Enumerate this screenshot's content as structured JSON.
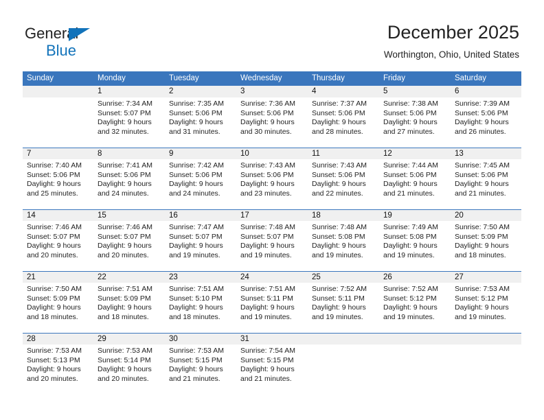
{
  "logo": {
    "word1": "General",
    "word2": "Blue",
    "accent_color": "#1273ba",
    "triangle_icon": "triangle-icon"
  },
  "header": {
    "title": "December 2025",
    "subtitle": "Worthington, Ohio, United States"
  },
  "theme": {
    "header_blue": "#3a76bd",
    "daynum_gray": "#f0f0f0",
    "text": "#222222"
  },
  "weekdays": [
    "Sunday",
    "Monday",
    "Tuesday",
    "Wednesday",
    "Thursday",
    "Friday",
    "Saturday"
  ],
  "weeks": [
    [
      {
        "day": "",
        "sunrise": "",
        "sunset": "",
        "daylight1": "",
        "daylight2": ""
      },
      {
        "day": "1",
        "sunrise": "Sunrise: 7:34 AM",
        "sunset": "Sunset: 5:07 PM",
        "daylight1": "Daylight: 9 hours",
        "daylight2": "and 32 minutes."
      },
      {
        "day": "2",
        "sunrise": "Sunrise: 7:35 AM",
        "sunset": "Sunset: 5:06 PM",
        "daylight1": "Daylight: 9 hours",
        "daylight2": "and 31 minutes."
      },
      {
        "day": "3",
        "sunrise": "Sunrise: 7:36 AM",
        "sunset": "Sunset: 5:06 PM",
        "daylight1": "Daylight: 9 hours",
        "daylight2": "and 30 minutes."
      },
      {
        "day": "4",
        "sunrise": "Sunrise: 7:37 AM",
        "sunset": "Sunset: 5:06 PM",
        "daylight1": "Daylight: 9 hours",
        "daylight2": "and 28 minutes."
      },
      {
        "day": "5",
        "sunrise": "Sunrise: 7:38 AM",
        "sunset": "Sunset: 5:06 PM",
        "daylight1": "Daylight: 9 hours",
        "daylight2": "and 27 minutes."
      },
      {
        "day": "6",
        "sunrise": "Sunrise: 7:39 AM",
        "sunset": "Sunset: 5:06 PM",
        "daylight1": "Daylight: 9 hours",
        "daylight2": "and 26 minutes."
      }
    ],
    [
      {
        "day": "7",
        "sunrise": "Sunrise: 7:40 AM",
        "sunset": "Sunset: 5:06 PM",
        "daylight1": "Daylight: 9 hours",
        "daylight2": "and 25 minutes."
      },
      {
        "day": "8",
        "sunrise": "Sunrise: 7:41 AM",
        "sunset": "Sunset: 5:06 PM",
        "daylight1": "Daylight: 9 hours",
        "daylight2": "and 24 minutes."
      },
      {
        "day": "9",
        "sunrise": "Sunrise: 7:42 AM",
        "sunset": "Sunset: 5:06 PM",
        "daylight1": "Daylight: 9 hours",
        "daylight2": "and 24 minutes."
      },
      {
        "day": "10",
        "sunrise": "Sunrise: 7:43 AM",
        "sunset": "Sunset: 5:06 PM",
        "daylight1": "Daylight: 9 hours",
        "daylight2": "and 23 minutes."
      },
      {
        "day": "11",
        "sunrise": "Sunrise: 7:43 AM",
        "sunset": "Sunset: 5:06 PM",
        "daylight1": "Daylight: 9 hours",
        "daylight2": "and 22 minutes."
      },
      {
        "day": "12",
        "sunrise": "Sunrise: 7:44 AM",
        "sunset": "Sunset: 5:06 PM",
        "daylight1": "Daylight: 9 hours",
        "daylight2": "and 21 minutes."
      },
      {
        "day": "13",
        "sunrise": "Sunrise: 7:45 AM",
        "sunset": "Sunset: 5:06 PM",
        "daylight1": "Daylight: 9 hours",
        "daylight2": "and 21 minutes."
      }
    ],
    [
      {
        "day": "14",
        "sunrise": "Sunrise: 7:46 AM",
        "sunset": "Sunset: 5:07 PM",
        "daylight1": "Daylight: 9 hours",
        "daylight2": "and 20 minutes."
      },
      {
        "day": "15",
        "sunrise": "Sunrise: 7:46 AM",
        "sunset": "Sunset: 5:07 PM",
        "daylight1": "Daylight: 9 hours",
        "daylight2": "and 20 minutes."
      },
      {
        "day": "16",
        "sunrise": "Sunrise: 7:47 AM",
        "sunset": "Sunset: 5:07 PM",
        "daylight1": "Daylight: 9 hours",
        "daylight2": "and 19 minutes."
      },
      {
        "day": "17",
        "sunrise": "Sunrise: 7:48 AM",
        "sunset": "Sunset: 5:07 PM",
        "daylight1": "Daylight: 9 hours",
        "daylight2": "and 19 minutes."
      },
      {
        "day": "18",
        "sunrise": "Sunrise: 7:48 AM",
        "sunset": "Sunset: 5:08 PM",
        "daylight1": "Daylight: 9 hours",
        "daylight2": "and 19 minutes."
      },
      {
        "day": "19",
        "sunrise": "Sunrise: 7:49 AM",
        "sunset": "Sunset: 5:08 PM",
        "daylight1": "Daylight: 9 hours",
        "daylight2": "and 19 minutes."
      },
      {
        "day": "20",
        "sunrise": "Sunrise: 7:50 AM",
        "sunset": "Sunset: 5:09 PM",
        "daylight1": "Daylight: 9 hours",
        "daylight2": "and 18 minutes."
      }
    ],
    [
      {
        "day": "21",
        "sunrise": "Sunrise: 7:50 AM",
        "sunset": "Sunset: 5:09 PM",
        "daylight1": "Daylight: 9 hours",
        "daylight2": "and 18 minutes."
      },
      {
        "day": "22",
        "sunrise": "Sunrise: 7:51 AM",
        "sunset": "Sunset: 5:09 PM",
        "daylight1": "Daylight: 9 hours",
        "daylight2": "and 18 minutes."
      },
      {
        "day": "23",
        "sunrise": "Sunrise: 7:51 AM",
        "sunset": "Sunset: 5:10 PM",
        "daylight1": "Daylight: 9 hours",
        "daylight2": "and 18 minutes."
      },
      {
        "day": "24",
        "sunrise": "Sunrise: 7:51 AM",
        "sunset": "Sunset: 5:11 PM",
        "daylight1": "Daylight: 9 hours",
        "daylight2": "and 19 minutes."
      },
      {
        "day": "25",
        "sunrise": "Sunrise: 7:52 AM",
        "sunset": "Sunset: 5:11 PM",
        "daylight1": "Daylight: 9 hours",
        "daylight2": "and 19 minutes."
      },
      {
        "day": "26",
        "sunrise": "Sunrise: 7:52 AM",
        "sunset": "Sunset: 5:12 PM",
        "daylight1": "Daylight: 9 hours",
        "daylight2": "and 19 minutes."
      },
      {
        "day": "27",
        "sunrise": "Sunrise: 7:53 AM",
        "sunset": "Sunset: 5:12 PM",
        "daylight1": "Daylight: 9 hours",
        "daylight2": "and 19 minutes."
      }
    ],
    [
      {
        "day": "28",
        "sunrise": "Sunrise: 7:53 AM",
        "sunset": "Sunset: 5:13 PM",
        "daylight1": "Daylight: 9 hours",
        "daylight2": "and 20 minutes."
      },
      {
        "day": "29",
        "sunrise": "Sunrise: 7:53 AM",
        "sunset": "Sunset: 5:14 PM",
        "daylight1": "Daylight: 9 hours",
        "daylight2": "and 20 minutes."
      },
      {
        "day": "30",
        "sunrise": "Sunrise: 7:53 AM",
        "sunset": "Sunset: 5:15 PM",
        "daylight1": "Daylight: 9 hours",
        "daylight2": "and 21 minutes."
      },
      {
        "day": "31",
        "sunrise": "Sunrise: 7:54 AM",
        "sunset": "Sunset: 5:15 PM",
        "daylight1": "Daylight: 9 hours",
        "daylight2": "and 21 minutes."
      },
      {
        "day": "",
        "sunrise": "",
        "sunset": "",
        "daylight1": "",
        "daylight2": ""
      },
      {
        "day": "",
        "sunrise": "",
        "sunset": "",
        "daylight1": "",
        "daylight2": ""
      },
      {
        "day": "",
        "sunrise": "",
        "sunset": "",
        "daylight1": "",
        "daylight2": ""
      }
    ]
  ]
}
